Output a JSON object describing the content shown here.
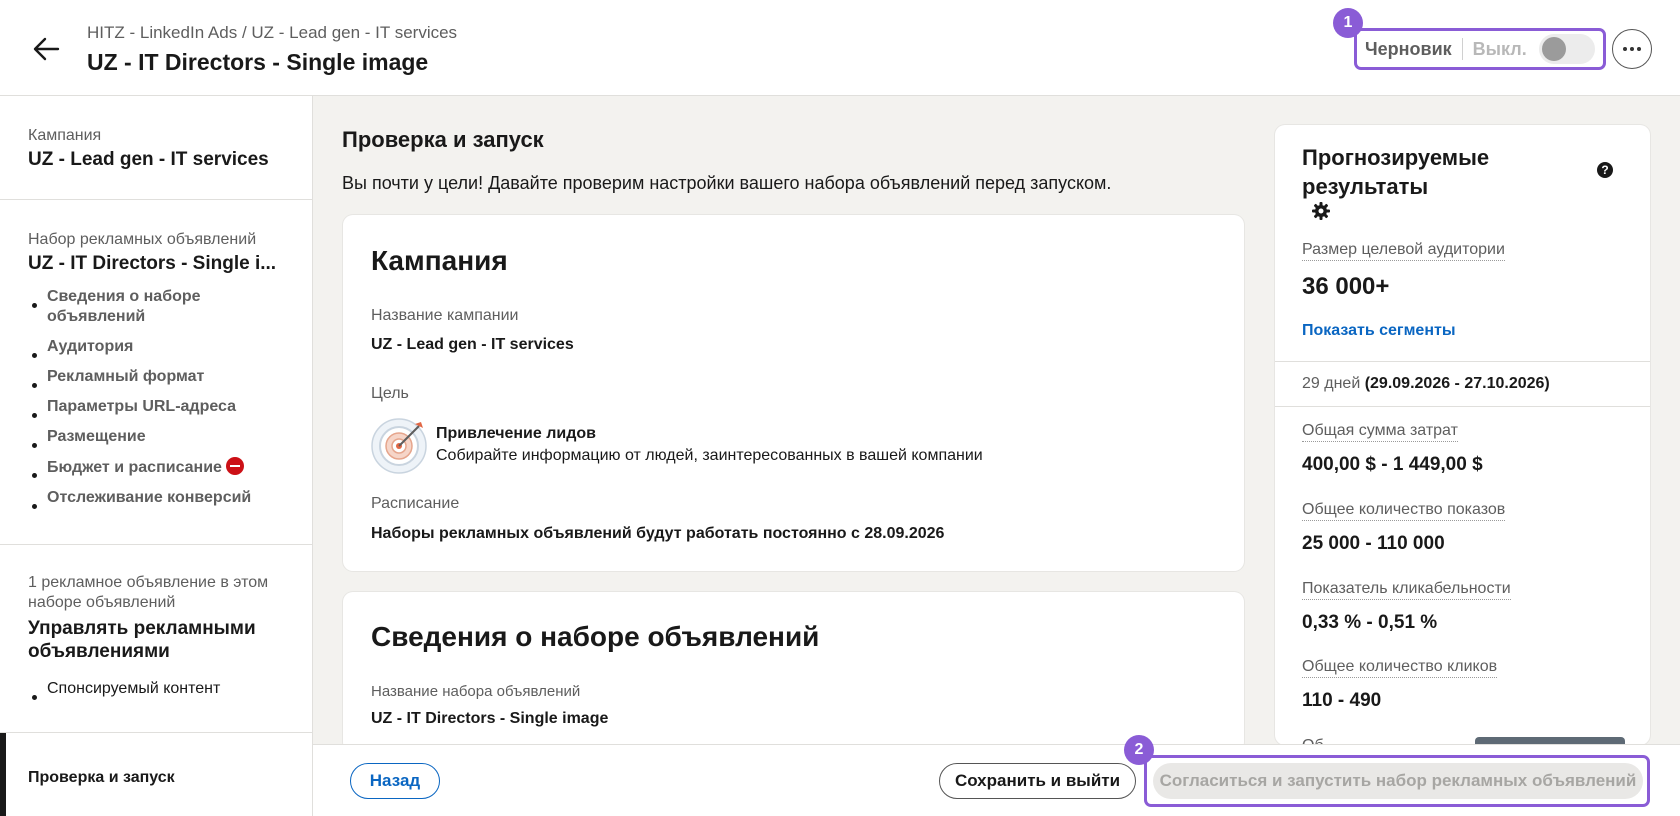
{
  "header": {
    "breadcrumb": "HITZ - LinkedIn Ads / UZ - Lead gen - IT services",
    "title": "UZ - IT Directors - Single image",
    "status_draft": "Черновик",
    "status_off": "Выкл.",
    "badge_1": "1",
    "badge_2": "2"
  },
  "sidebar": {
    "campaign_label": "Кампания",
    "campaign_name": "UZ - Lead gen - IT services",
    "adset_label": "Набор рекламных объявлений",
    "adset_name": "UZ - IT Directors - Single i...",
    "items": [
      "Сведения о наборе объявлений",
      "Аудитория",
      "Рекламный формат",
      "Параметры URL-адреса",
      "Размещение",
      "Бюджет и расписание",
      "Отслеживание конверсий"
    ],
    "ads_label": "1 рекламное объявление в этом наборе объявлений",
    "ads_manage": "Управлять рекламными объявлениями",
    "ads_items": [
      "Спонсируемый контент"
    ],
    "active_step": "Проверка и запуск"
  },
  "main": {
    "title": "Проверка и запуск",
    "subtitle": "Вы почти у цели! Давайте проверим настройки вашего набора объявлений перед запуском.",
    "campaign_card": {
      "heading": "Кампания",
      "name_label": "Название кампании",
      "name_value": "UZ - Lead gen - IT services",
      "goal_label": "Цель",
      "goal_title": "Привлечение лидов",
      "goal_desc": "Собирайте информацию от людей, заинтересованных в вашей компании",
      "schedule_label": "Расписание",
      "schedule_value": "Наборы рекламных объявлений будут работать постоянно с 28.09.2026"
    },
    "adset_card": {
      "heading": "Сведения о наборе объявлений",
      "name_label": "Название набора объявлений",
      "name_value": "UZ - IT Directors - Single image"
    }
  },
  "forecast": {
    "title": "Прогнозируемые результаты",
    "audience_label": "Размер целевой аудитории",
    "audience_value": "36 000+",
    "show_segments": "Показать сегменты",
    "days": "29 дней",
    "date_range": "(29.09.2026 - 27.10.2026)",
    "spend_label": "Общая сумма затрат",
    "spend_value": "400,00 $ - 1 449,00 $",
    "impressions_label": "Общее количество показов",
    "impressions_value": "25 000 - 110 000",
    "ctr_label": "Показатель кликабельности",
    "ctr_value": "0,33 % - 0,51 %",
    "clicks_label": "Общее количество кликов",
    "clicks_value": "110 - 490",
    "cut_text": "Об"
  },
  "footer": {
    "back": "Назад",
    "save_exit": "Сохранить и выйти",
    "launch": "Согласиться и запустить набор рекламных объявлений"
  },
  "colors": {
    "accent": "#0a66c2",
    "highlight": "#8a5cd6",
    "error": "#cc1016"
  }
}
